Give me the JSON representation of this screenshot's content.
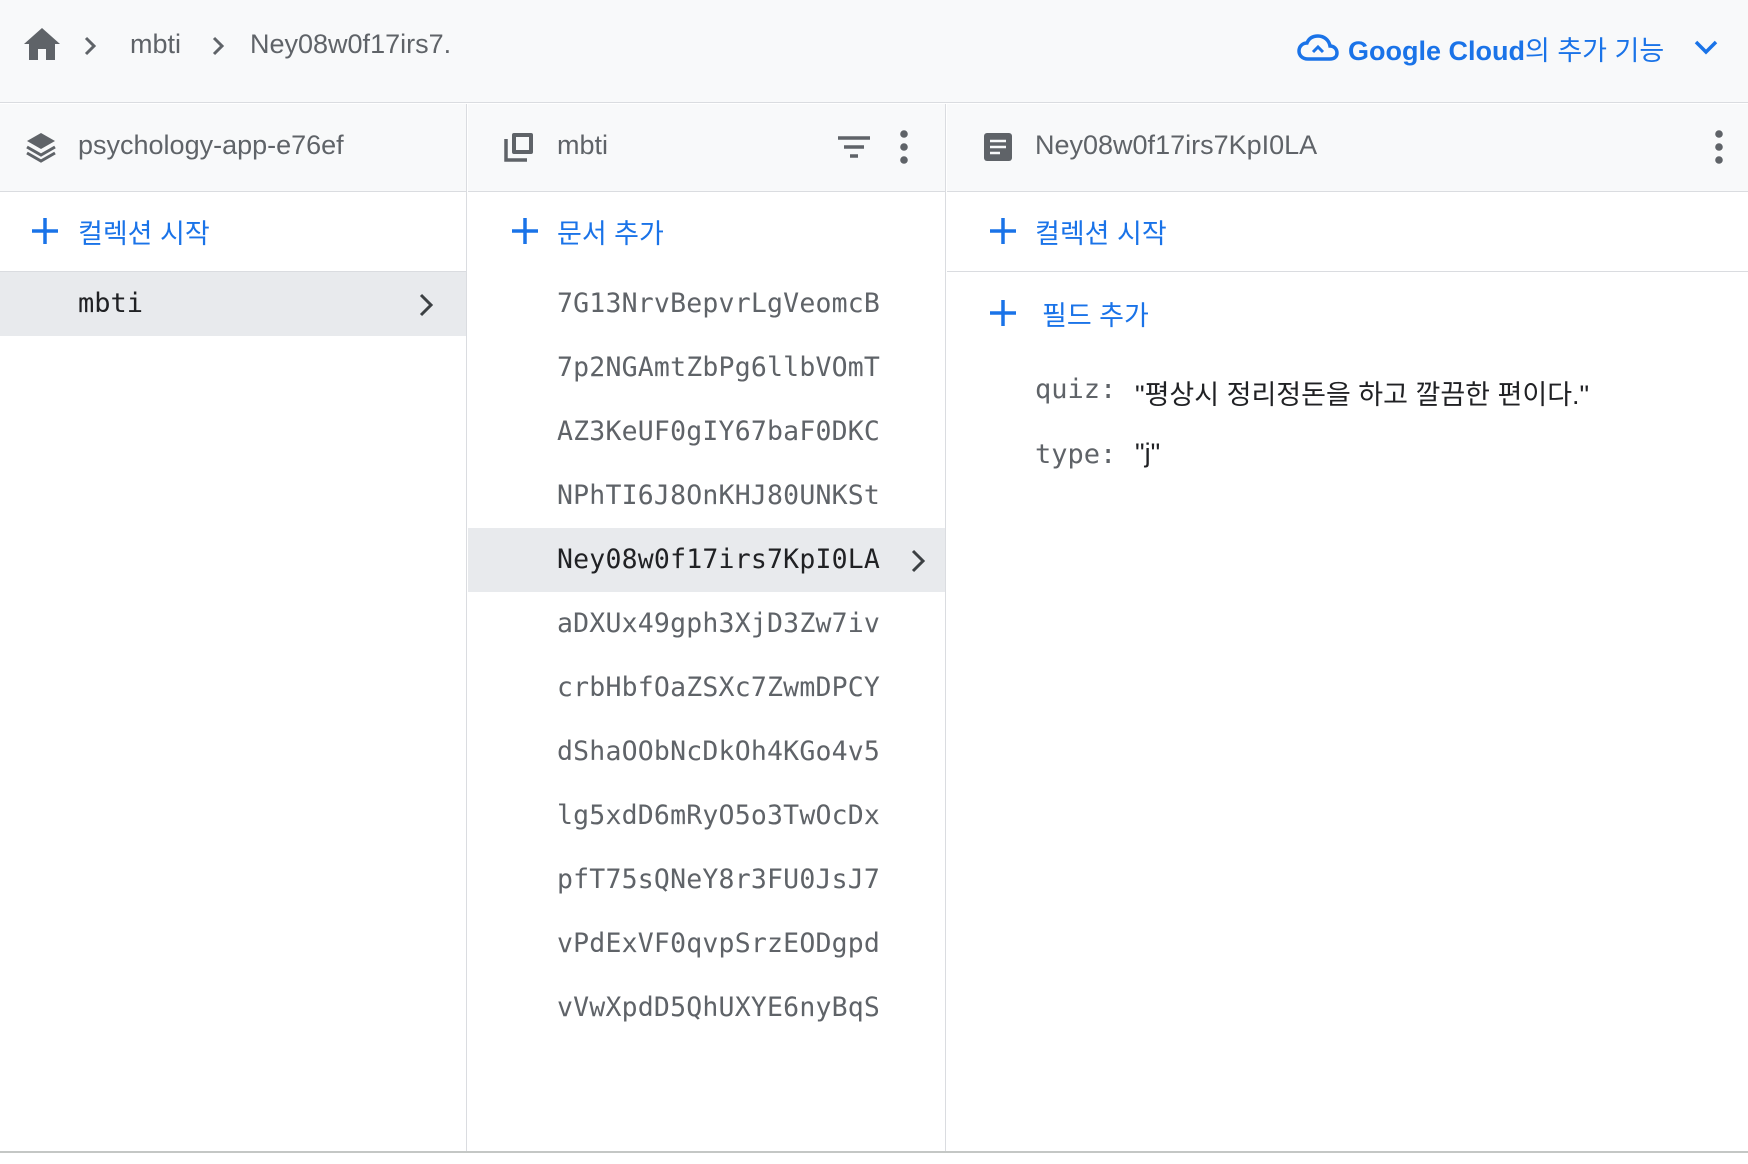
{
  "breadcrumb": {
    "items": [
      "mbti",
      "Ney08w0f17irs7."
    ]
  },
  "google_cloud": {
    "label_bold": "Google Cloud",
    "label_rest": "의 추가 기능"
  },
  "panel_project": {
    "title": "psychology-app-e76ef",
    "start_collection_label": "컬렉션 시작",
    "collections": [
      "mbti"
    ]
  },
  "panel_collection": {
    "title": "mbti",
    "add_document_label": "문서 추가",
    "documents": [
      "7G13NrvBepvrLgVeomcB",
      "7p2NGAmtZbPg6llbVOmT",
      "AZ3KeUF0gIY67baF0DKC",
      "NPhTI6J8OnKHJ80UNKSt",
      "Ney08w0f17irs7KpI0LA",
      "aDXUx49gph3XjD3Zw7iv",
      "crbHbfOaZSXc7ZwmDPCY",
      "dShaOObNcDkOh4KGo4v5",
      "lg5xdD6mRyO5o3TwOcDx",
      "pfT75sQNeY8r3FU0JsJ7",
      "vPdExVF0qvpSrzEODgpd",
      "vVwXpdD5QhUXYE6nyBqS"
    ],
    "selected_document": "Ney08w0f17irs7KpI0LA"
  },
  "panel_document": {
    "title": "Ney08w0f17irs7KpI0LA",
    "start_collection_label": "컬렉션 시작",
    "add_field_label": "필드 추가",
    "fields": [
      {
        "key": "quiz:",
        "value": "\"평상시 정리정돈을 하고 깔끔한 편이다.\""
      },
      {
        "key": "type:",
        "value": "\"j\""
      }
    ]
  },
  "colors": {
    "accent": "#1a73e8",
    "selected_bg": "#e8eaed",
    "header_bg": "#f8f9fa",
    "border": "#dadce0"
  },
  "icons": {
    "home": "home-icon",
    "breadcrumb_separator": "chevron-right-icon",
    "cloud": "cloud-icon",
    "dropdown": "chevron-down-icon",
    "project": "layers-icon",
    "collection": "collection-icon",
    "filter": "filter-icon",
    "more": "more-vert-icon",
    "document": "document-icon",
    "add": "plus-icon"
  }
}
